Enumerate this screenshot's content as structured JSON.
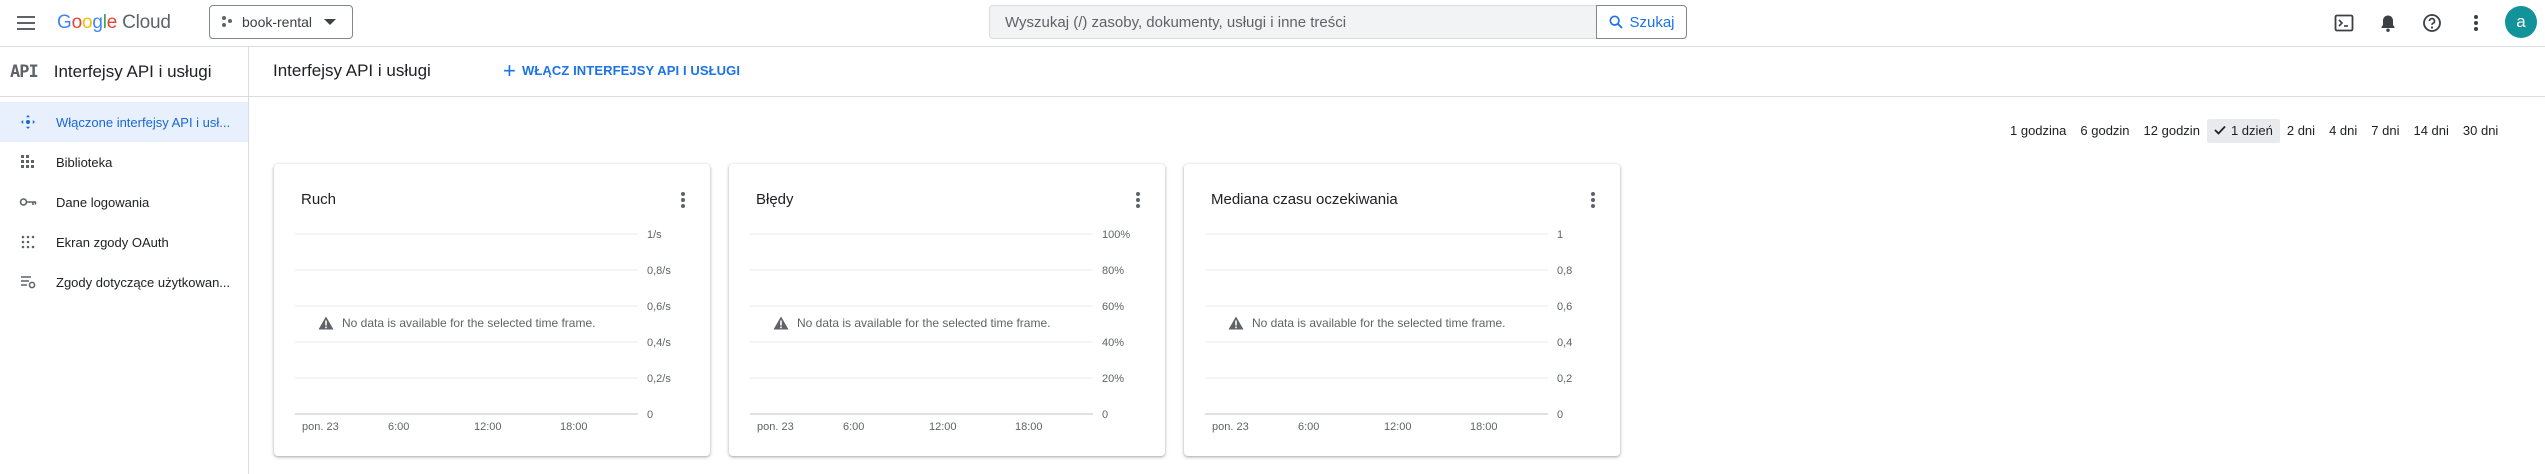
{
  "header": {
    "logo_google": "Google",
    "logo_cloud": "Cloud",
    "project": "book-rental",
    "search_placeholder": "Wyszukaj (/) zasoby, dokumenty, usługi i inne treści",
    "search_button": "Szukaj",
    "avatar_letter": "a",
    "icons": [
      "cloud-shell-icon",
      "notifications-icon",
      "help-icon",
      "more-vert-icon"
    ]
  },
  "sidebar": {
    "badge": "API",
    "title": "Interfejsy API i usługi",
    "items": [
      {
        "label": "Włączone interfejsy API i usł...",
        "icon": "enabled-apis-icon",
        "active": true
      },
      {
        "label": "Biblioteka",
        "icon": "library-icon"
      },
      {
        "label": "Dane logowania",
        "icon": "key-icon"
      },
      {
        "label": "Ekran zgody OAuth",
        "icon": "oauth-icon"
      },
      {
        "label": "Zgody dotyczące użytkowan...",
        "icon": "consent-icon"
      }
    ]
  },
  "main": {
    "title": "Interfejsy API i usługi",
    "enable_button": "WŁĄCZ INTERFEJSY API I USŁUGI",
    "time_ranges": [
      "1 godzina",
      "6 godzin",
      "12 godzin",
      "1 dzień",
      "2 dni",
      "4 dni",
      "7 dni",
      "14 dni",
      "30 dni"
    ],
    "selected_range": "1 dzień",
    "no_data_text": "No data is available for the selected time frame."
  },
  "chart_data": [
    {
      "type": "line",
      "title": "Ruch",
      "x_ticks": [
        "pon. 23",
        "6:00",
        "12:00",
        "18:00"
      ],
      "y_ticks": [
        "0",
        "0,2/s",
        "0,4/s",
        "0,6/s",
        "0,8/s",
        "1/s"
      ],
      "ylim": [
        0,
        1
      ],
      "series": []
    },
    {
      "type": "line",
      "title": "Błędy",
      "x_ticks": [
        "pon. 23",
        "6:00",
        "12:00",
        "18:00"
      ],
      "y_ticks": [
        "0",
        "20%",
        "40%",
        "60%",
        "80%",
        "100%"
      ],
      "ylim": [
        0,
        100
      ],
      "series": []
    },
    {
      "type": "line",
      "title": "Mediana czasu oczekiwania",
      "x_ticks": [
        "pon. 23",
        "6:00",
        "12:00",
        "18:00"
      ],
      "y_ticks": [
        "0",
        "0,2",
        "0,4",
        "0,6",
        "0,8",
        "1"
      ],
      "ylim": [
        0,
        1
      ],
      "series": []
    }
  ]
}
